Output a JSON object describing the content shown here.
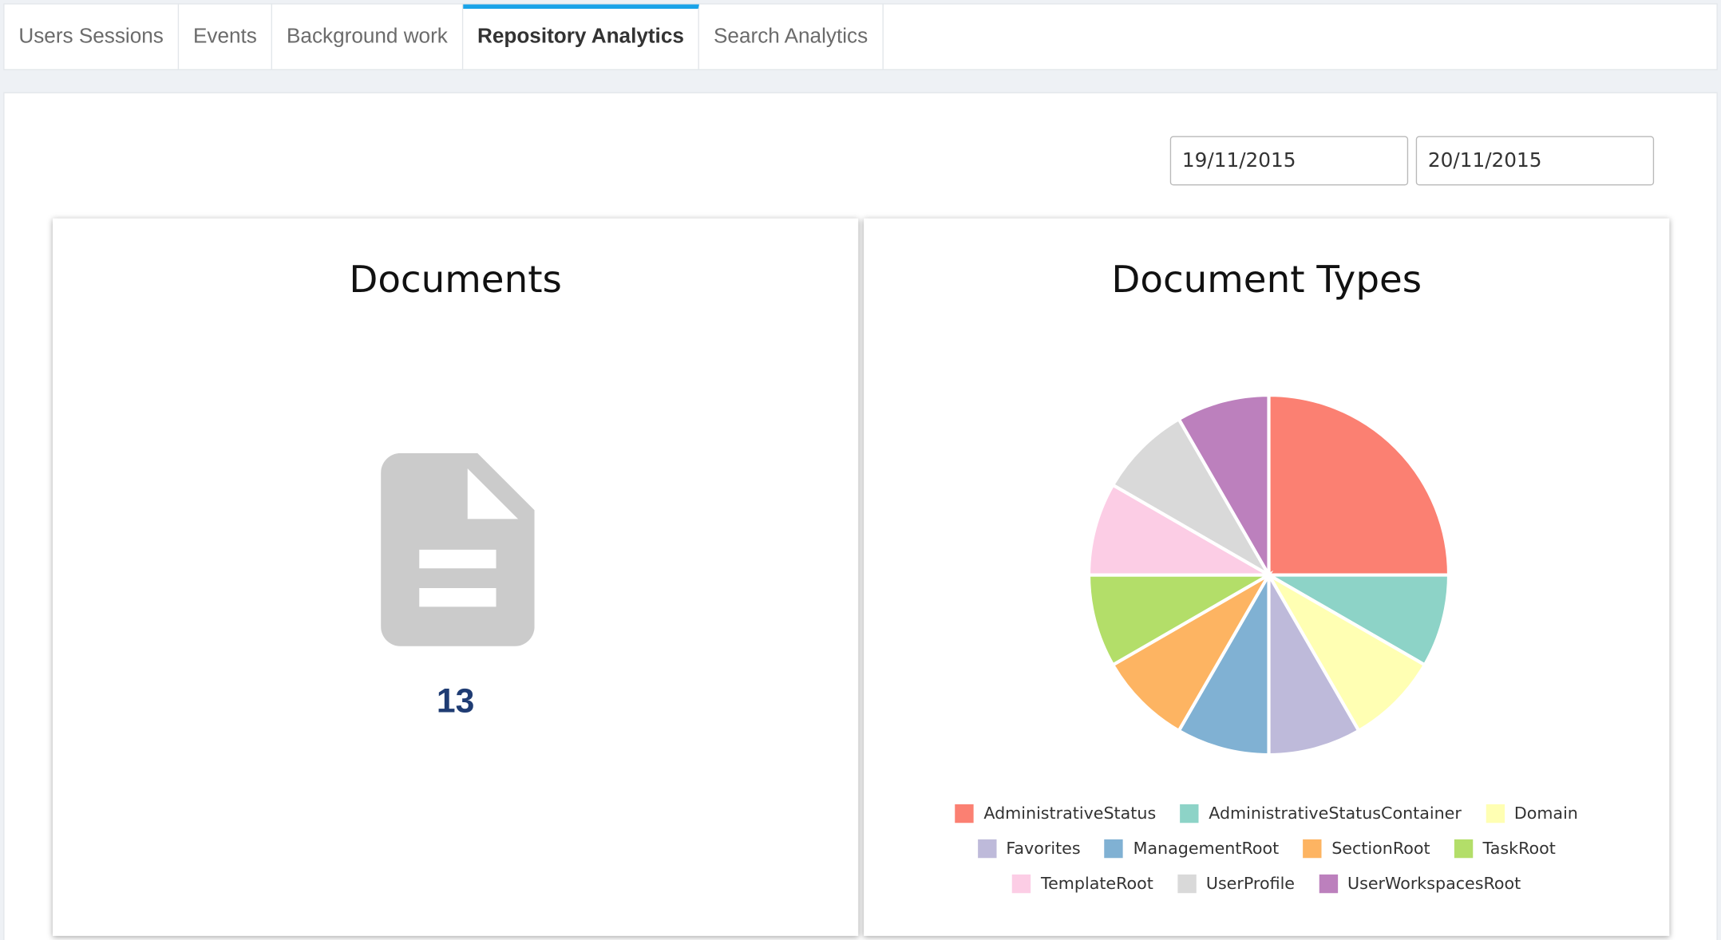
{
  "tabs": [
    {
      "label": "Users Sessions",
      "active": false
    },
    {
      "label": "Events",
      "active": false
    },
    {
      "label": "Background work",
      "active": false
    },
    {
      "label": "Repository Analytics",
      "active": true
    },
    {
      "label": "Search Analytics",
      "active": false
    }
  ],
  "date_range": {
    "from": "19/11/2015",
    "to": "20/11/2015"
  },
  "documents_card": {
    "title": "Documents",
    "count": "13",
    "icon": "document-icon"
  },
  "types_card": {
    "title": "Document Types"
  },
  "chart_data": {
    "type": "pie",
    "title": "Document Types",
    "categories": [
      "AdministrativeStatus",
      "AdministrativeStatusContainer",
      "Domain",
      "Favorites",
      "ManagementRoot",
      "SectionRoot",
      "TaskRoot",
      "TemplateRoot",
      "UserProfile",
      "UserWorkspacesRoot"
    ],
    "values": [
      3,
      1,
      1,
      1,
      1,
      1,
      1,
      1,
      1,
      1
    ],
    "colors": [
      "#fb8072",
      "#8dd3c7",
      "#ffffb3",
      "#bebada",
      "#80b1d3",
      "#fdb462",
      "#b3de69",
      "#fccde5",
      "#d9d9d9",
      "#bc80bd"
    ],
    "legend": "bottom"
  }
}
